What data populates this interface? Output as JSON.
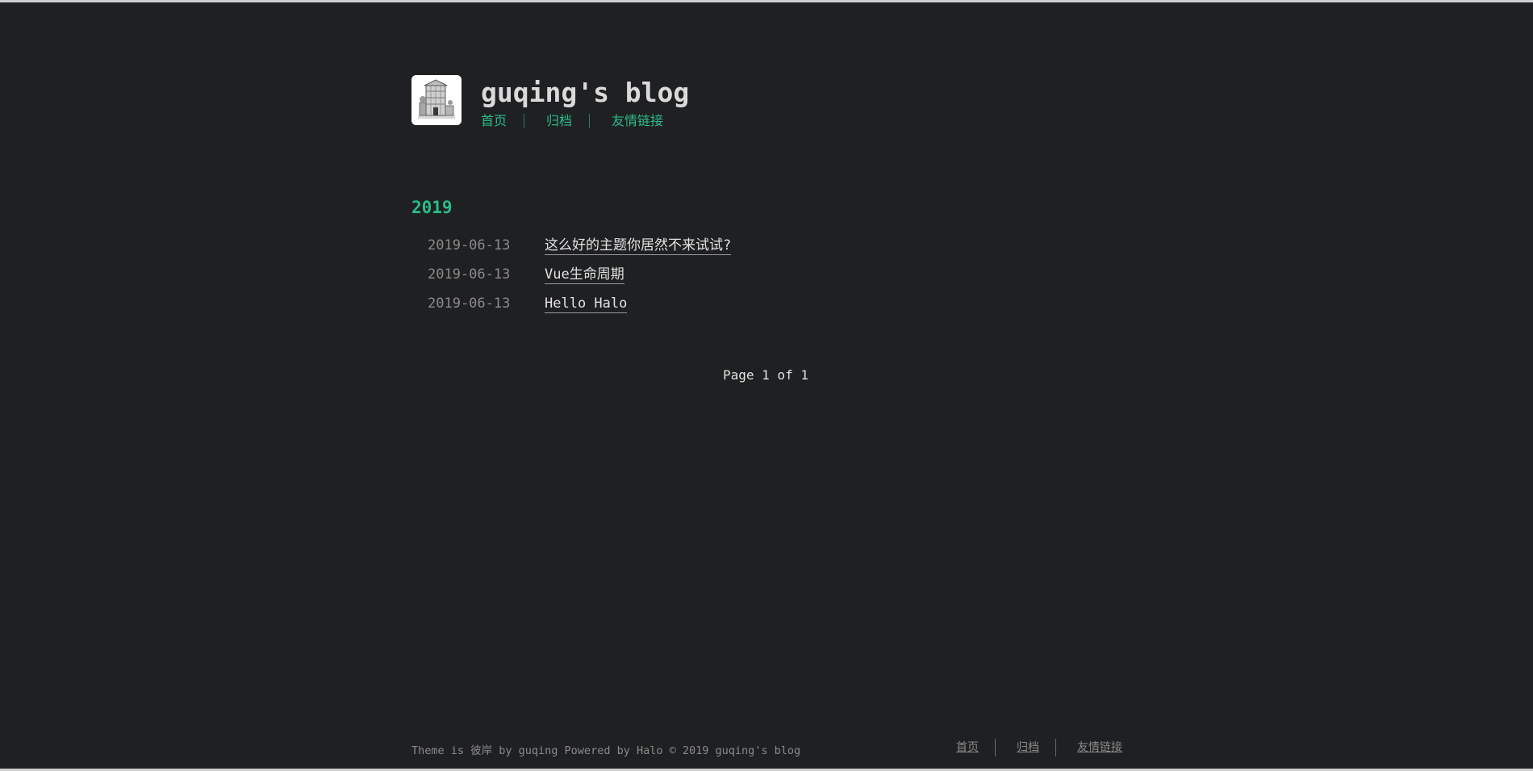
{
  "site": {
    "title": "guqing's blog"
  },
  "nav": {
    "items": [
      {
        "label": "首页"
      },
      {
        "label": "归档"
      },
      {
        "label": "友情链接"
      }
    ]
  },
  "archive": {
    "year": "2019",
    "posts": [
      {
        "date": "2019-06-13",
        "title": "这么好的主题你居然不来试试?"
      },
      {
        "date": "2019-06-13",
        "title": "Vue生命周期"
      },
      {
        "date": "2019-06-13",
        "title": "Hello Halo"
      }
    ]
  },
  "pagination": {
    "text": "Page 1 of 1"
  },
  "footer": {
    "text": "Theme is 彼岸 by guqing Powered by Halo © 2019 guqing's blog",
    "nav": [
      {
        "label": "首页"
      },
      {
        "label": "归档"
      },
      {
        "label": "友情链接"
      }
    ]
  },
  "colors": {
    "background": "#1f2022",
    "accent": "#2bbc8a",
    "text": "#e2e2e2",
    "muted": "#8a8a8a"
  },
  "icons": {
    "logo": "building-sketch-avatar"
  }
}
